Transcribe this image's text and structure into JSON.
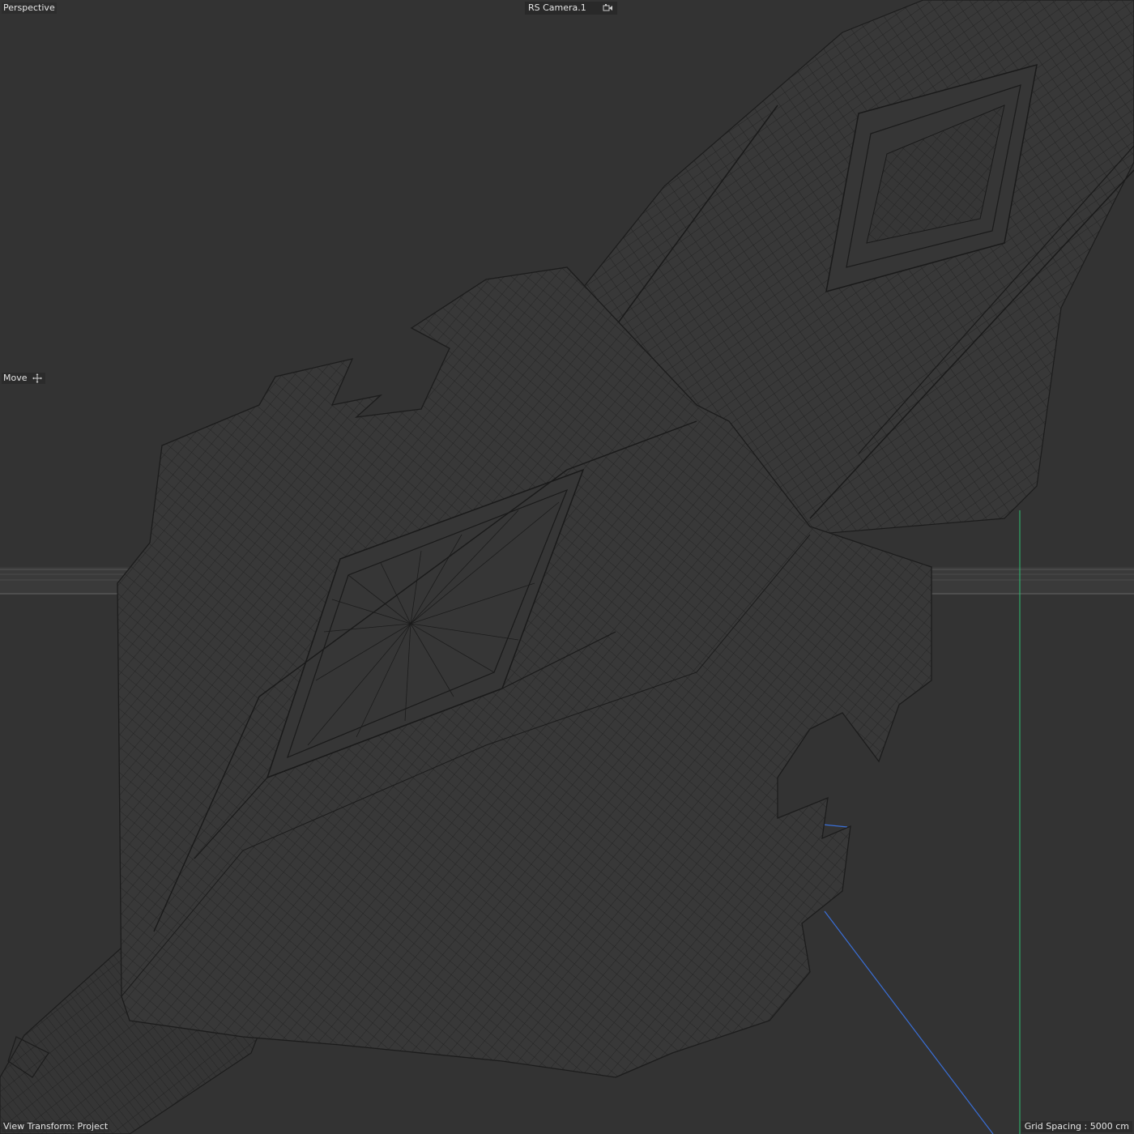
{
  "viewport": {
    "view_name": "Perspective",
    "camera_name": "RS Camera.1",
    "camera_icon": "camera-link-icon",
    "active_tool": "Move",
    "active_tool_icon": "move-arrows-icon",
    "view_transform": "View Transform: Project",
    "grid_spacing": "Grid Spacing : 5000 cm"
  },
  "colors": {
    "background": "#333333",
    "wire": "#1f1f1f",
    "mesh_fill": "#383838",
    "axis_y": "#2fbf71",
    "axis_z": "#3a6fd8",
    "horizon": "#5a5a5a"
  }
}
